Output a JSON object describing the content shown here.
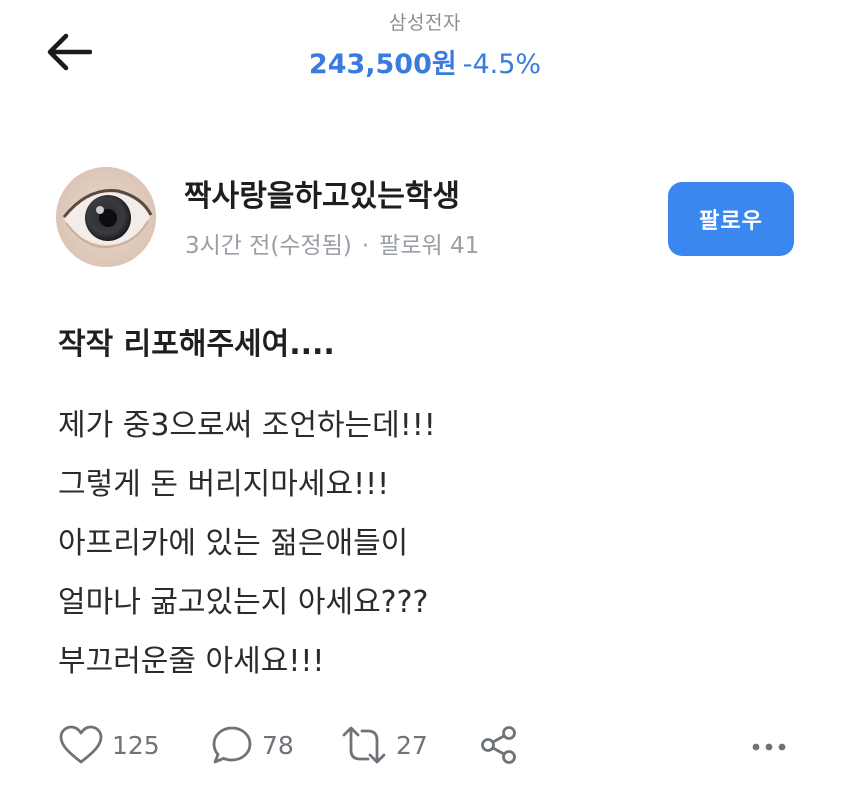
{
  "header": {
    "stock_name": "삼성전자",
    "price": "243,500원",
    "change": "-4.5%",
    "accent_color": "#3a7be0"
  },
  "author": {
    "name": "짝사랑을하고있는학생",
    "time": "3시간 전(수정됨)",
    "separator": "·",
    "followers": "팔로워 41",
    "follow_label": "팔로우"
  },
  "post": {
    "title": "작작 리포해주세여....",
    "lines": [
      "제가 중3으로써 조언하는데!!!",
      "그렇게 돈 버리지마세요!!!",
      "아프리카에 있는 젊은애들이",
      "얼마나 굶고있는지 아세요???",
      "부끄러운줄 아세요!!!"
    ]
  },
  "actions": {
    "likes": "125",
    "comments": "78",
    "reposts": "27"
  },
  "icons": {
    "back": "arrow-left-icon",
    "like": "heart-icon",
    "comment": "speech-bubble-icon",
    "repost": "repost-icon",
    "share": "share-icon",
    "more": "more-horizontal-icon"
  }
}
